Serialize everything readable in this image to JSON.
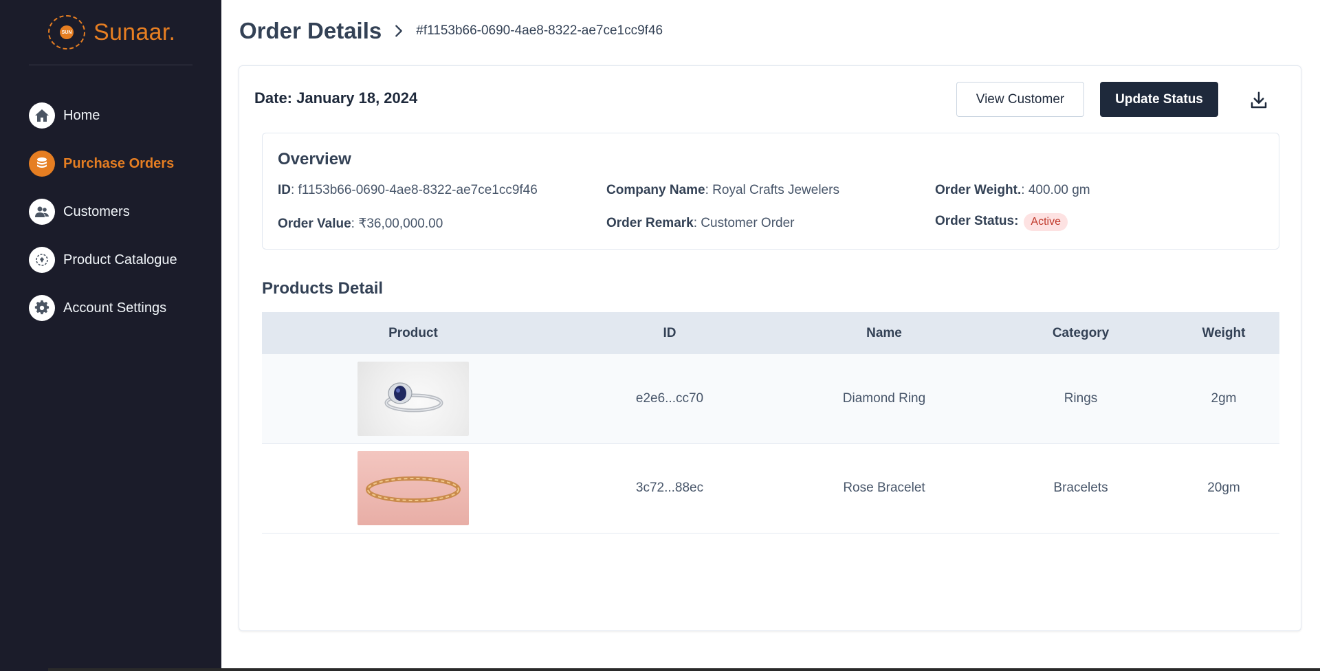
{
  "brand": {
    "name": "Sunaar.",
    "logo_text": "SUN"
  },
  "sidebar": {
    "items": [
      {
        "label": "Home",
        "icon": "home-icon",
        "active": false
      },
      {
        "label": "Purchase Orders",
        "icon": "coins-icon",
        "active": true
      },
      {
        "label": "Customers",
        "icon": "users-icon",
        "active": false
      },
      {
        "label": "Product Catalogue",
        "icon": "catalogue-icon",
        "active": false
      },
      {
        "label": "Account Settings",
        "icon": "gear-icon",
        "active": false
      }
    ]
  },
  "header": {
    "title": "Order Details",
    "order_ref": "#f1153b66-0690-4ae8-8322-ae7ce1cc9f46"
  },
  "order": {
    "date_line": "Date: January 18, 2024",
    "view_customer_label": "View Customer",
    "update_status_label": "Update Status"
  },
  "overview": {
    "title": "Overview",
    "id_label": "ID",
    "id_value": ": f1153b66-0690-4ae8-8322-ae7ce1cc9f46",
    "company_label": "Company Name",
    "company_value": ": Royal Crafts Jewelers",
    "weight_label": "Order Weight.",
    "weight_value": ": 400.00 gm",
    "value_label": "Order Value",
    "value_value": ": ₹36,00,000.00",
    "remark_label": "Order Remark",
    "remark_value": ": Customer Order",
    "status_label": "Order Status:",
    "status_value": "Active"
  },
  "products": {
    "title": "Products Detail",
    "columns": [
      "Product",
      "ID",
      "Name",
      "Category",
      "Weight"
    ],
    "rows": [
      {
        "image": "sapphire-ring-photo",
        "id": "e2e6...cc70",
        "name": "Diamond Ring",
        "category": "Rings",
        "weight": "2gm"
      },
      {
        "image": "rose-bracelet-photo",
        "id": "3c72...88ec",
        "name": "Rose Bracelet",
        "category": "Bracelets",
        "weight": "20gm"
      }
    ]
  },
  "colors": {
    "sidebar_bg": "#1b1c2a",
    "accent": "#e67e22",
    "primary_button": "#1e293b",
    "status_active_bg": "#fde2e2",
    "status_active_text": "#c0392b"
  }
}
